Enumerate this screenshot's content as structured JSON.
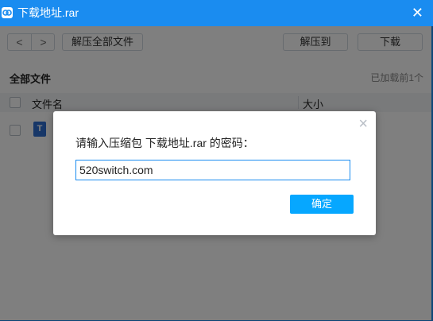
{
  "window": {
    "title": "下载地址.rar",
    "close_symbol": "✕"
  },
  "toolbar": {
    "back_symbol": "<",
    "forward_symbol": ">",
    "extract_all_label": "解压全部文件",
    "extract_to_label": "解压到",
    "download_label": "下载"
  },
  "list": {
    "section_label": "全部文件",
    "loaded_count": "已加载前1个",
    "columns": {
      "name": "文件名",
      "size": "大小"
    },
    "rows": [
      {
        "icon_letter": "T"
      }
    ]
  },
  "dialog": {
    "close_symbol": "×",
    "prompt": "请输入压缩包 下载地址.rar 的密码：",
    "input_value": "520switch.com",
    "ok_label": "确定"
  },
  "colors": {
    "titlebar": "#1a8cf0",
    "ok_button": "#06a7ff",
    "file_icon": "#2f6fd0"
  }
}
